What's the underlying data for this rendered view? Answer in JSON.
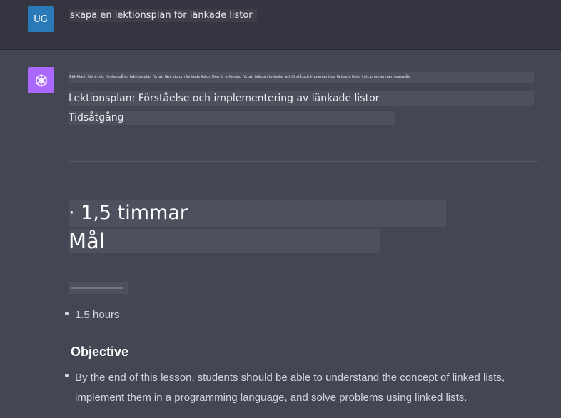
{
  "user_message": {
    "avatar_initials": "UG",
    "text": "skapa en lektionsplan för länkade listor"
  },
  "assistant_message": {
    "avatar_icon": "openai-logo-icon",
    "intro_line": "Självklart, här är ett förslag på en lektionsplan för att lära sig om länkade listor. Den är utformad för att hjälpa studenter att förstå och implementera länkade listor i ett programmeringsspråk.",
    "lesson_heading": "Lektionsplan: Förståelse och implementering av länkade listor",
    "time_heading": "Tidsåtgång",
    "duration_large": "· 1,5 timmar",
    "goal_large": "Mål",
    "duration_bullet": "1.5 hours",
    "objective_heading": "Objective",
    "objective_bullet": "By the end of this lesson, students should be able to understand the concept of linked lists, implement them in a programming language, and solve problems using linked lists."
  },
  "colors": {
    "background": "#444654",
    "user_row": "#343541",
    "user_avatar": "#2a7ab8",
    "assistant_avatar": "#ab68ff",
    "highlight": "#4e505e"
  }
}
